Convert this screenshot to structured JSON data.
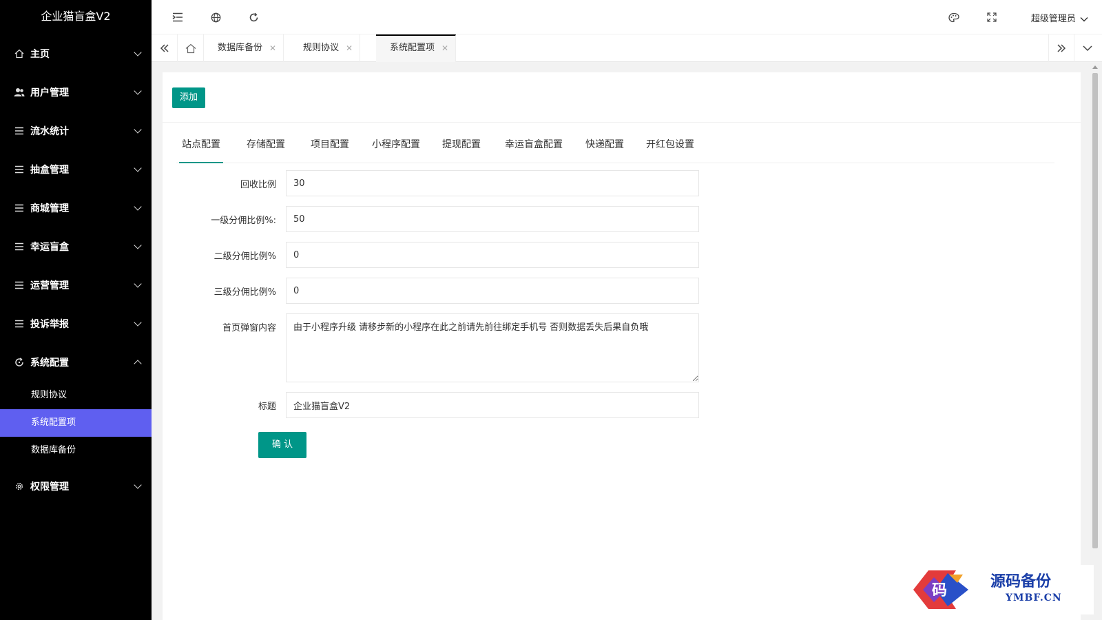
{
  "app": {
    "brand": "企业猫盲盒V2"
  },
  "sidebar": {
    "items": [
      {
        "label": "主页",
        "icon": "home-icon"
      },
      {
        "label": "用户管理",
        "icon": "users-icon"
      },
      {
        "label": "流水统计",
        "icon": "list-icon"
      },
      {
        "label": "抽盒管理",
        "icon": "list-icon"
      },
      {
        "label": "商城管理",
        "icon": "list-icon"
      },
      {
        "label": "幸运盲盒",
        "icon": "list-icon"
      },
      {
        "label": "运营管理",
        "icon": "list-icon"
      },
      {
        "label": "投诉举报",
        "icon": "list-icon"
      },
      {
        "label": "系统配置",
        "icon": "refresh-icon",
        "expanded": true
      },
      {
        "label": "权限管理",
        "icon": "gear-icon"
      }
    ],
    "sub_items": [
      {
        "label": "规则协议"
      },
      {
        "label": "系统配置项",
        "active": true
      },
      {
        "label": "数据库备份"
      }
    ]
  },
  "header": {
    "user": "超级管理员"
  },
  "tabs": [
    {
      "label": "数据库备份"
    },
    {
      "label": "规则协议"
    },
    {
      "label": "系统配置项",
      "active": true
    }
  ],
  "toolbar": {
    "add_label": "添加"
  },
  "config_tabs": [
    "站点配置",
    "存储配置",
    "项目配置",
    "小程序配置",
    "提现配置",
    "幸运盲盒配置",
    "快递配置",
    "开红包设置"
  ],
  "form": {
    "recycle_ratio": {
      "label": "回收比例",
      "value": "30"
    },
    "level1": {
      "label": "一级分佣比例%:",
      "value": "50"
    },
    "level2": {
      "label": "二级分佣比例%",
      "value": "0"
    },
    "level3": {
      "label": "三级分佣比例%",
      "value": "0"
    },
    "popup": {
      "label": "首页弹窗内容",
      "value": "由于小程序升级 请移步新的小程序在此之前请先前往绑定手机号 否则数据丢失后果自负哦"
    },
    "title": {
      "label": "标题",
      "value": "企业猫盲盒V2"
    },
    "confirm_label": "确 认"
  },
  "watermark": {
    "text": "源码备份",
    "sub": "YMBF.CN",
    "logo_char": "码"
  },
  "colors": {
    "sidebar_bg": "#000000",
    "active_sub": "#5f5ff0",
    "primary": "#009688"
  }
}
